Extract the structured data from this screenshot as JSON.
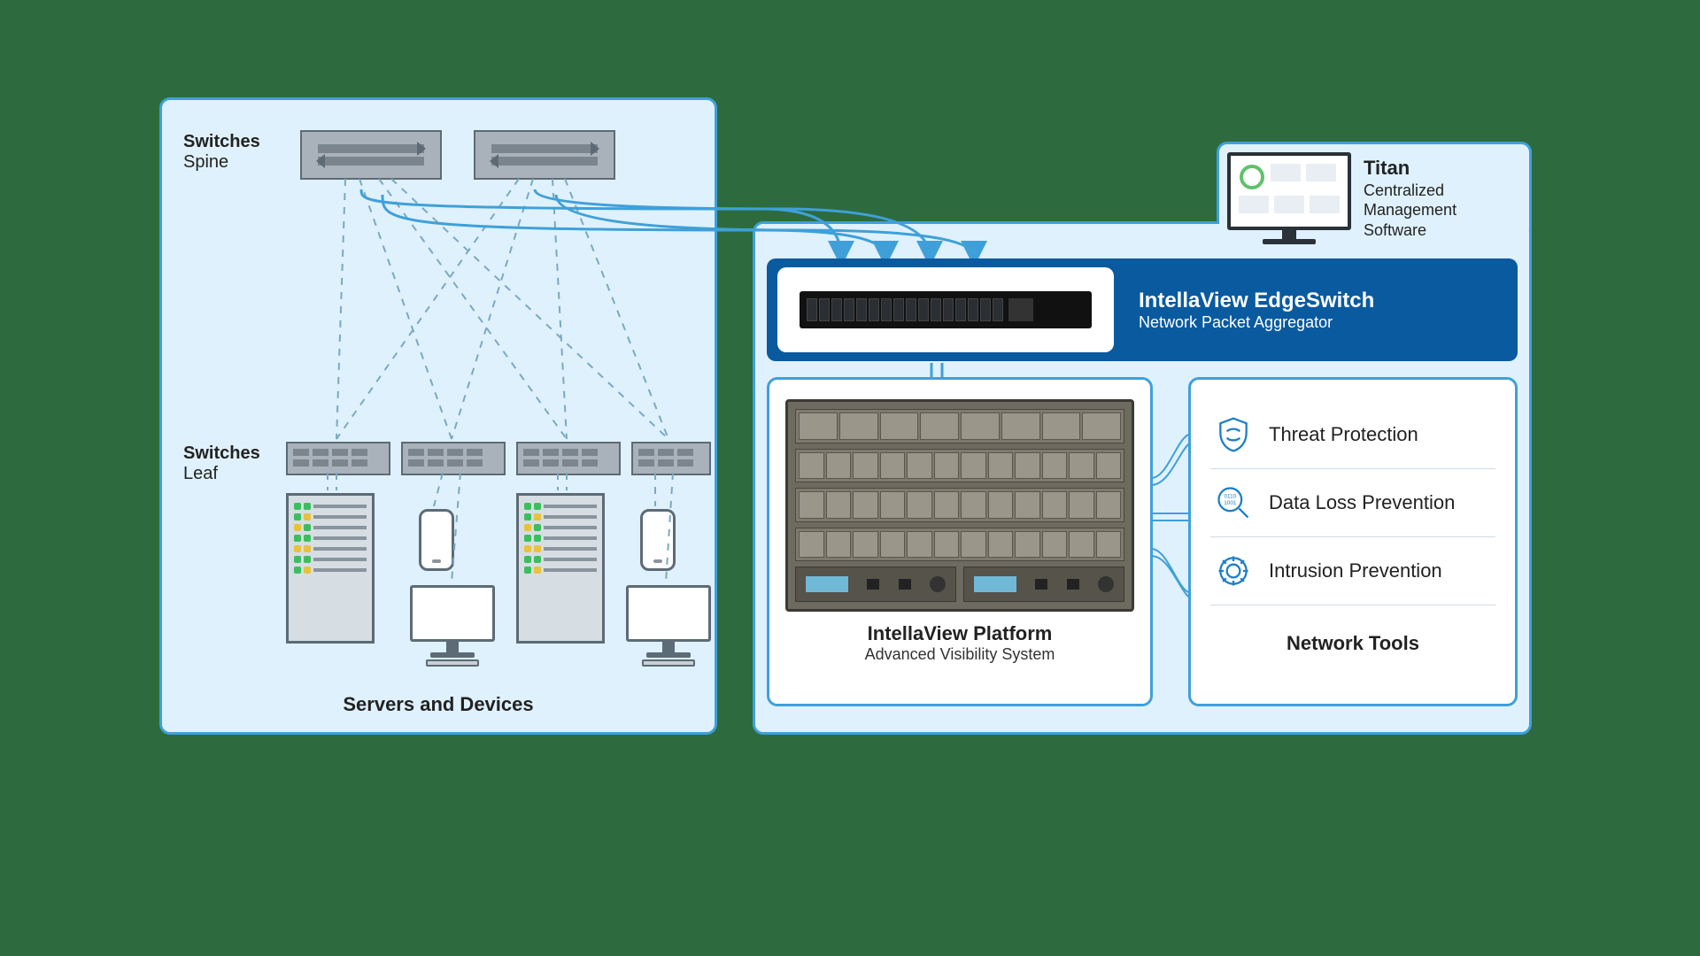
{
  "left": {
    "spine": {
      "label_bold": "Switches",
      "label_sub": "Spine"
    },
    "leaf": {
      "label_bold": "Switches",
      "label_sub": "Leaf"
    },
    "footer": "Servers and Devices"
  },
  "titan": {
    "title": "Titan",
    "line1": "Centralized",
    "line2": "Management",
    "line3": "Software"
  },
  "edge": {
    "title": "IntellaView EdgeSwitch",
    "sub": "Network Packet Aggregator"
  },
  "platform": {
    "title": "IntellaView Platform",
    "sub": "Advanced Visibility System"
  },
  "tools": {
    "items": [
      "Threat Protection",
      "Data Loss Prevention",
      "Intrusion Prevention"
    ],
    "footer": "Network Tools"
  }
}
